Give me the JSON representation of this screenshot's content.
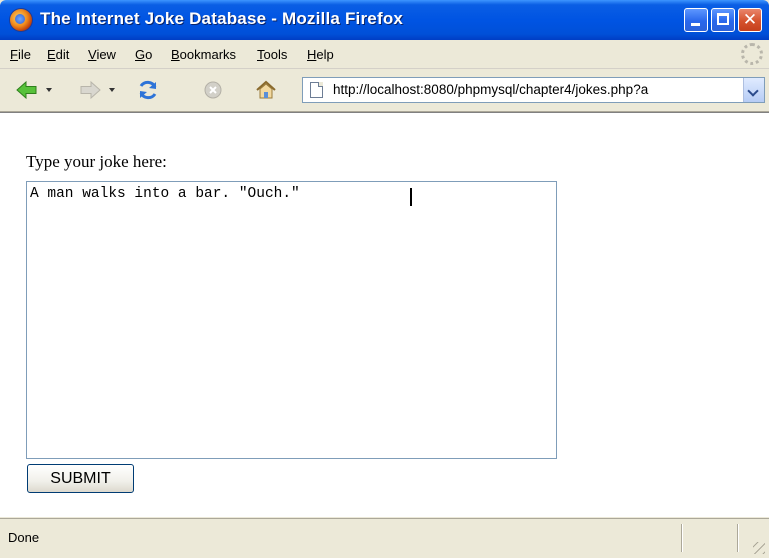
{
  "window": {
    "title": "The Internet Joke Database - Mozilla Firefox",
    "close_glyph": "✕"
  },
  "menu": {
    "items": [
      {
        "label": "File"
      },
      {
        "label": "Edit"
      },
      {
        "label": "View"
      },
      {
        "label": "Go"
      },
      {
        "label": "Bookmarks"
      },
      {
        "label": "Tools"
      },
      {
        "label": "Help"
      }
    ]
  },
  "toolbar": {
    "icons": [
      "back-arrow-icon",
      "forward-arrow-icon",
      "reload-icon",
      "stop-icon",
      "home-icon"
    ],
    "url": "http://localhost:8080/phpmysql/chapter4/jokes.php?a"
  },
  "form": {
    "prompt": "Type your joke here:",
    "joke_text": "A man walks into a bar. \"Ouch.\"",
    "submit_label": "SUBMIT"
  },
  "status": {
    "text": "Done"
  },
  "colors": {
    "titlebar": "#0054e3",
    "chrome": "#ece9d8",
    "back_arrow": "#3fae2a",
    "reload": "#2e74d8"
  }
}
